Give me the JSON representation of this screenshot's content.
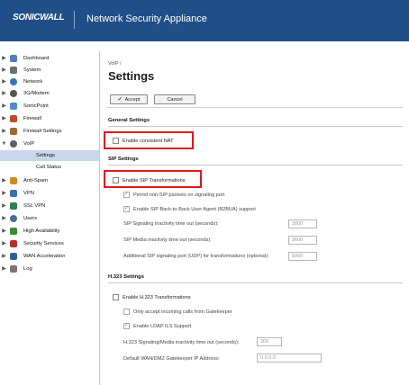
{
  "header": {
    "logo": "SONICWALL",
    "title": "Network Security Appliance"
  },
  "sidebar": {
    "items": [
      {
        "label": "Dashboard",
        "color": "#4f7fc1"
      },
      {
        "label": "System",
        "color": "#6e6e6e"
      },
      {
        "label": "Network",
        "color": "#3b73b9"
      },
      {
        "label": "3G/Modem",
        "color": "#555555"
      },
      {
        "label": "SonicPoint",
        "color": "#4b8fd1"
      },
      {
        "label": "Firewall",
        "color": "#c04a2a"
      },
      {
        "label": "Firewall Settings",
        "color": "#9a6a32"
      },
      {
        "label": "VoIP",
        "color": "#5f5f5f"
      }
    ],
    "subitems": [
      {
        "label": "Settings"
      },
      {
        "label": "Call Status"
      }
    ],
    "items2": [
      {
        "label": "Anti-Spam",
        "color": "#d18a1f"
      },
      {
        "label": "VPN",
        "color": "#3f6fb0"
      },
      {
        "label": "SSL VPN",
        "color": "#2f7f4f"
      },
      {
        "label": "Users",
        "color": "#4a6a9a"
      },
      {
        "label": "High Availability",
        "color": "#3a8a3a"
      },
      {
        "label": "Security Services",
        "color": "#b0302a"
      },
      {
        "label": "WAN Acceleration",
        "color": "#2f5f9f"
      },
      {
        "label": "Log",
        "color": "#777777"
      }
    ]
  },
  "main": {
    "breadcrumb": "VoIP /",
    "title": "Settings",
    "accept_label": "Accept",
    "cancel_label": "Cancel",
    "general": {
      "heading": "General Settings",
      "consistent_nat": "Enable consistent NAT"
    },
    "sip": {
      "heading": "SIP Settings",
      "transformations": "Enable SIP Transformations",
      "permit_non_sip": "Permit non-SIP packets on signaling port",
      "b2bua": "Enable SIP Back-to-Back User Agent (B2BUA) support",
      "signaling_timeout_label": "SIP Signaling inactivity time out (seconds):",
      "signaling_timeout_value": "3800",
      "media_timeout_label": "SIP Media inactivity time out (seconds):",
      "media_timeout_value": "3600",
      "additional_port_label": "Additional SIP signaling port (UDP) for transformations (optional):",
      "additional_port_value": "5060"
    },
    "h323": {
      "heading": "H.323 Settings",
      "transformations": "Enable H.323 Transformations",
      "only_gatekeeper": "Only accept incoming calls from Gatekeeper",
      "ldap": "Enable LDAP ILS Support",
      "timeout_label": "H.323 Signaling/Media inactivity time out (seconds):",
      "timeout_value": "300",
      "gatekeeper_ip_label": "Default WAN/DMZ Gatekeeper IP Address:",
      "gatekeeper_ip_value": "0.0.0.0"
    }
  },
  "colors": {
    "header_bg": "#1f4f86",
    "highlight": "#e0161c",
    "selected": "#c7d8ed"
  }
}
